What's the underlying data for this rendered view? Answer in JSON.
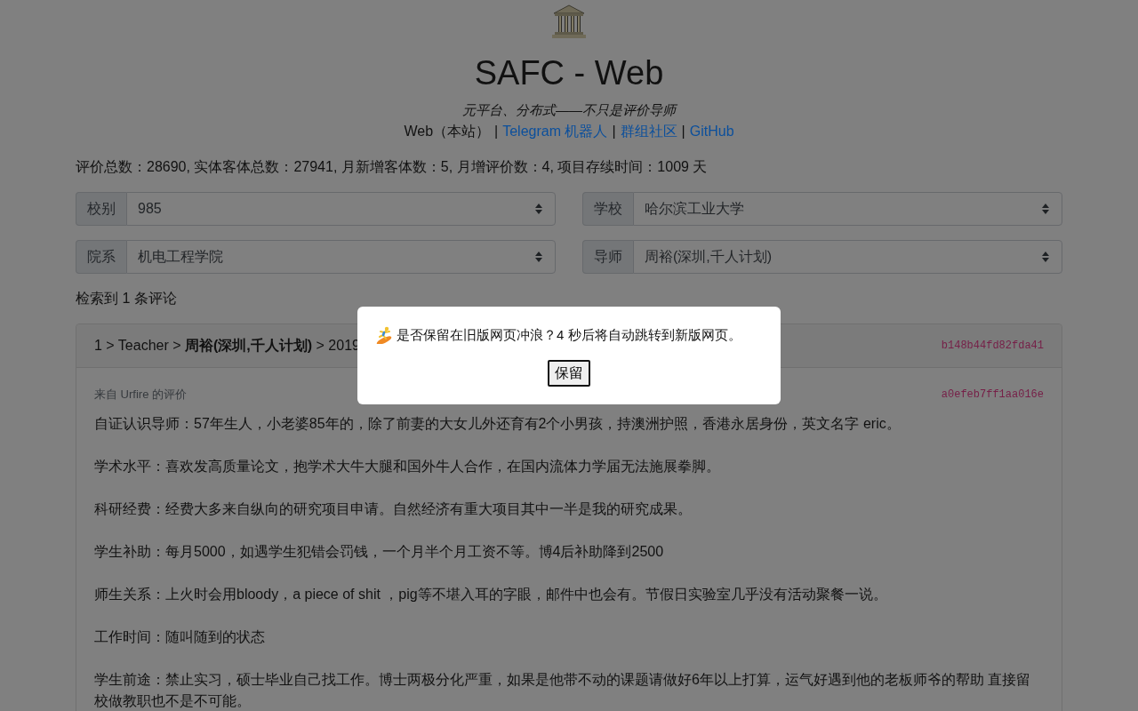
{
  "header": {
    "title": "SAFC - Web",
    "tagline": "元平台、分布式——不只是评价导师",
    "nav": [
      {
        "kind": "text",
        "label": "Web（本站）"
      },
      {
        "kind": "separator",
        "label": "|"
      },
      {
        "kind": "link",
        "label": "Telegram 机器人"
      },
      {
        "kind": "separator",
        "label": "|"
      },
      {
        "kind": "link",
        "label": "群组社区"
      },
      {
        "kind": "separator",
        "label": "|"
      },
      {
        "kind": "link",
        "label": "GitHub"
      }
    ]
  },
  "stats": "评价总数：28690, 实体客体总数：27941, 月新增客体数：5, 月增评价数：4, 项目存续时间：1009 天",
  "filters": [
    {
      "label": "校别",
      "value": "985"
    },
    {
      "label": "学校",
      "value": "哈尔滨工业大学"
    },
    {
      "label": "院系",
      "value": "机电工程学院"
    },
    {
      "label": "导师",
      "value": "周裕(深圳,千人计划)"
    }
  ],
  "result_count": "检索到 1 条评论",
  "card": {
    "breadcrumb": "1 > Teacher > **周裕(深圳,千人计划)** > 2019",
    "hash": "b148b44fd82fda41",
    "review": {
      "author_line": "来自 Urfire 的评价",
      "hash": "a0efeb7ff1aa016e",
      "paragraphs": [
        "自证认识导师：57年生人，小老婆85年的，除了前妻的大女儿外还育有2个小男孩，持澳洲护照，香港永居身份，英文名字 eric。",
        "学术水平：喜欢发高质量论文，抱学术大牛大腿和国外牛人合作，在国内流体力学届无法施展拳脚。",
        "科研经费：经费大多来自纵向的研究项目申请。自然经济有重大项目其中一半是我的研究成果。",
        "学生补助：每月5000，如遇学生犯错会罚钱，一个月半个月工资不等。博4后补助降到2500",
        "师生关系：上火时会用bloody，a piece of shit ，pig等不堪入耳的字眼，邮件中也会有。节假日实验室几乎没有活动聚餐一说。",
        "工作时间：随叫随到的状态",
        "学生前途：禁止实习，硕士毕业自己找工作。博士两极分化严重，如果是他带不动的课题请做好6年以上打算，运气好遇到他的老板师爷的帮助 直接留校做教职也不是不可能。"
      ]
    }
  },
  "modal": {
    "message": "是否保留在旧版网页冲浪？4 秒后将自动跳转到新版网页。",
    "button": "保留"
  }
}
